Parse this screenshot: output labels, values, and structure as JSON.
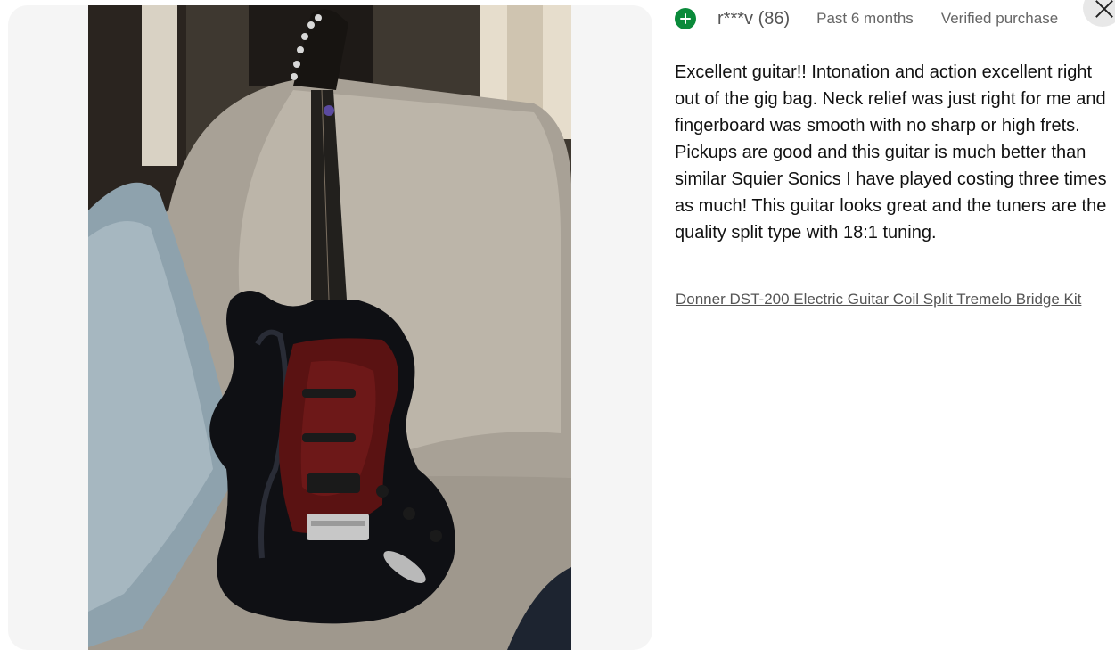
{
  "review": {
    "reviewer": "r***v (86)",
    "date": "Past 6 months",
    "verified": "Verified purchase",
    "text": "Excellent guitar!! Intonation and action excellent right out of the gig bag. Neck relief was just right for me and fingerboard was smooth with no sharp or high frets. Pickups are good and this guitar is much better than similar Squier Sonics I have played costing three times as much! This guitar looks great and the tuners are the quality split type with 18:1 tuning.",
    "product_link": "Donner DST-200 Electric Guitar Coil Split Tremelo Bridge Kit"
  },
  "icons": {
    "follow": "plus-circle-icon",
    "close": "close-icon"
  },
  "colors": {
    "follow_green": "#0a8a3a",
    "panel_bg": "#f5f5f5",
    "close_bg": "#e8e8e8"
  }
}
